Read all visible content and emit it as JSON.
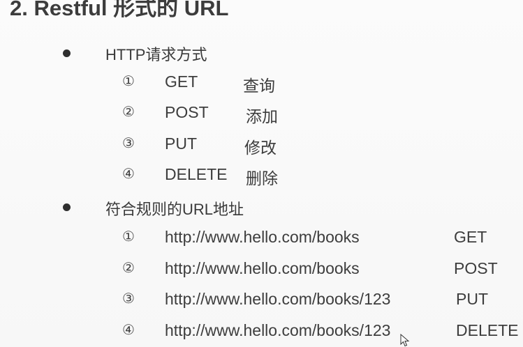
{
  "heading": "2. Restful 形式的 URL",
  "sections": [
    {
      "label": "HTTP请求方式",
      "items": [
        {
          "num": "①",
          "method": "GET",
          "desc": "查询"
        },
        {
          "num": "②",
          "method": "POST",
          "desc": "添加"
        },
        {
          "num": "③",
          "method": "PUT",
          "desc": "修改"
        },
        {
          "num": "④",
          "method": "DELETE",
          "desc": "删除"
        }
      ]
    },
    {
      "label": "符合规则的URL地址",
      "items": [
        {
          "num": "①",
          "url": "http://www.hello.com/books",
          "method": "GET"
        },
        {
          "num": "②",
          "url": "http://www.hello.com/books",
          "method": "POST"
        },
        {
          "num": "③",
          "url": "http://www.hello.com/books/123",
          "method": "PUT"
        },
        {
          "num": "④",
          "url": "http://www.hello.com/books/123",
          "method": "DELETE"
        }
      ]
    }
  ],
  "icons": {
    "bullet": "filled-circle",
    "cursor": "mouse-pointer-icon"
  }
}
